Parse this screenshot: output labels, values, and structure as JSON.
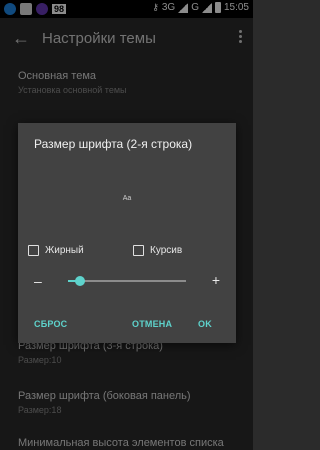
{
  "statusbar": {
    "app_badge": "98",
    "network": "3G",
    "network_alt": "G",
    "time": "15:05"
  },
  "toolbar": {
    "title": "Настройки темы"
  },
  "list": [
    {
      "title": "Основная тема",
      "subtitle": "Установка основной темы"
    },
    {
      "title": "Размер шрифта (3-я строка)",
      "subtitle": "Размер:10"
    },
    {
      "title": "Размер шрифта (боковая панель)",
      "subtitle": "Размер:18"
    },
    {
      "title": "Минимальная высота элементов списка",
      "subtitle": ""
    }
  ],
  "dialog": {
    "title": "Размер шрифта (2-я строка)",
    "preview": "Aa",
    "bold_label": "Жирный",
    "italic_label": "Курсив",
    "minus": "–",
    "plus": "+",
    "slider_value": 0.1,
    "reset_label": "СБРОС",
    "cancel_label": "ОТМЕНА",
    "ok_label": "OK"
  },
  "colors": {
    "accent": "#5ed3cc",
    "dialog_bg": "#424242",
    "background": "#2b2b2b"
  }
}
